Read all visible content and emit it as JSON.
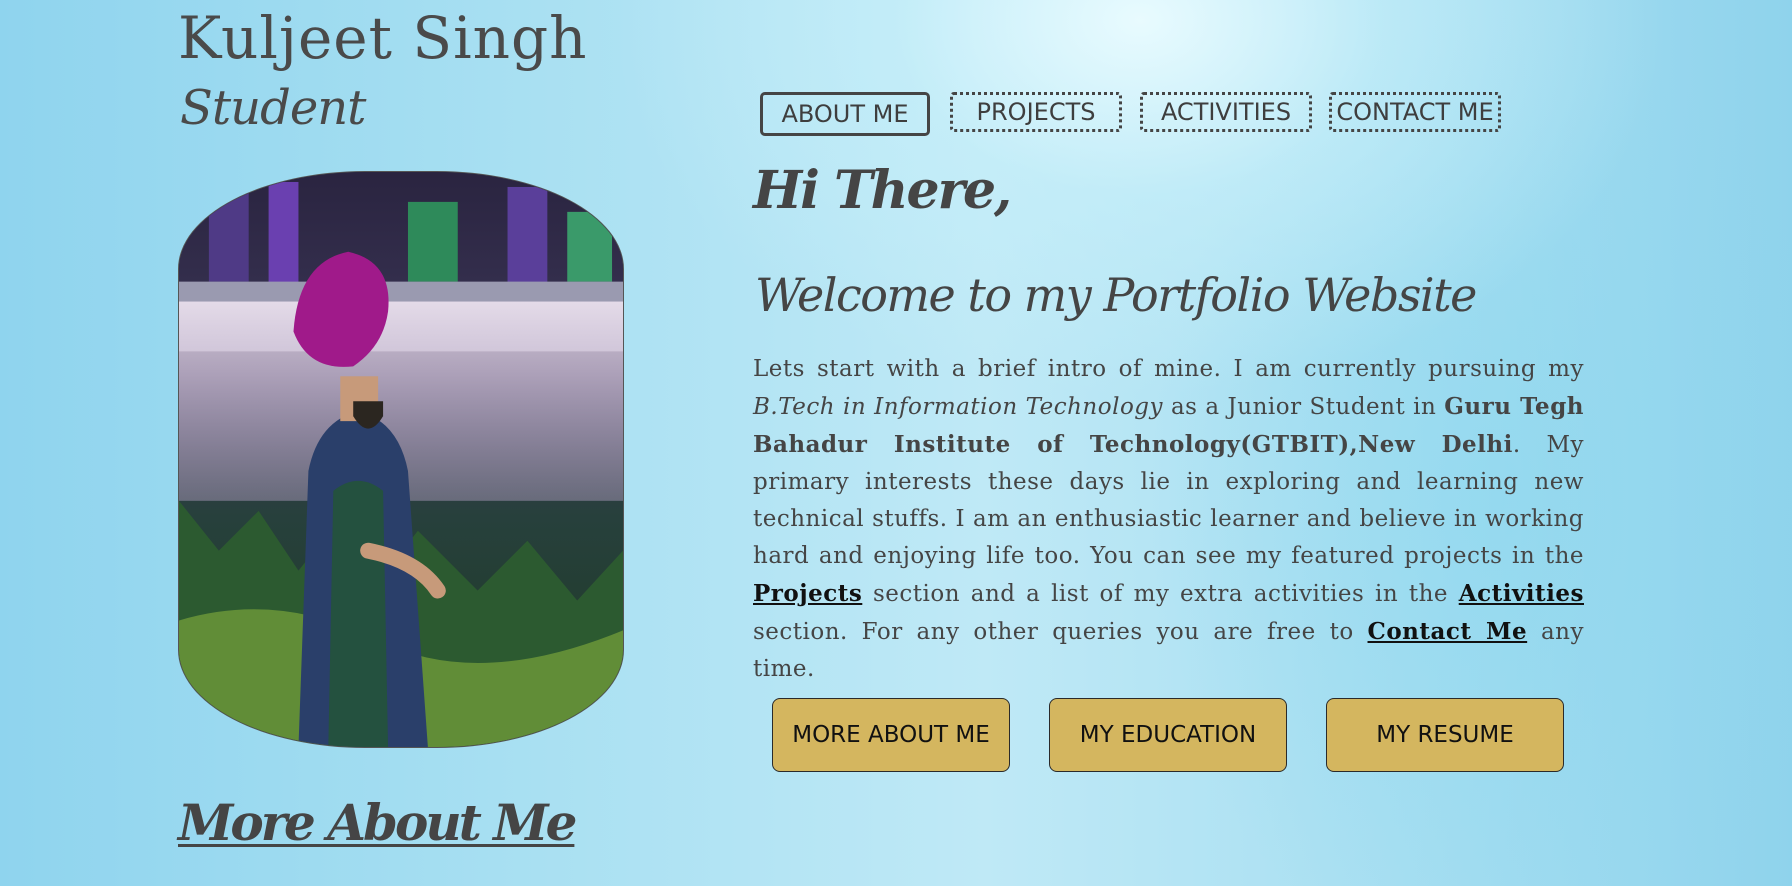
{
  "header": {
    "name": "Kuljeet Singh",
    "role": "Student"
  },
  "nav": {
    "items": [
      {
        "label": "ABOUT ME",
        "active": true
      },
      {
        "label": "PROJECTS",
        "active": false
      },
      {
        "label": "ACTIVITIES",
        "active": false
      },
      {
        "label": "CONTACT ME",
        "active": false
      }
    ]
  },
  "hero": {
    "greeting": "Hi There,",
    "welcome": "Welcome to my Portfolio Website",
    "intro": {
      "part1": "Lets start with a brief intro of mine. I am currently pursuing my ",
      "degree": "B.Tech in Information Technology",
      "part2": " as a Junior Student in ",
      "college": "Guru Tegh Bahadur Institute of Technology(GTBIT),New Delhi",
      "part3": ". My primary interests these days lie in exploring and learning new technical stuffs. I am an enthusiastic learner and believe in working hard and enjoying life too. You can see my featured projects in the ",
      "projects_link": "Projects",
      "part4": " section and a list of my extra activities in the ",
      "activities_link": "Activities",
      "part5": " section. For any other queries you are free to ",
      "contact_link": "Contact Me",
      "part6": " any time."
    }
  },
  "actions": {
    "more_about": "MORE ABOUT ME",
    "education": "MY EDUCATION",
    "resume": "MY RESUME"
  },
  "sections": {
    "more_about_title": "More About Me"
  },
  "colors": {
    "text": "#454545",
    "button_gold": "#d4b65f",
    "link": "#111111"
  }
}
